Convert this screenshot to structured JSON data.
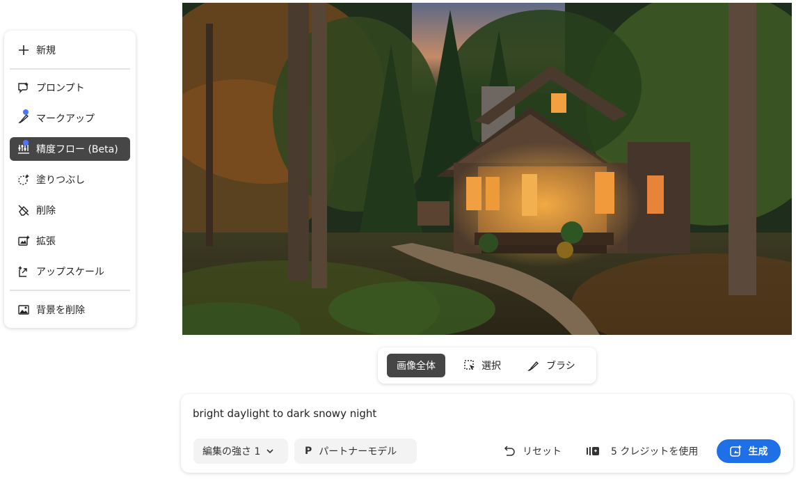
{
  "tools": {
    "new_label": "新規",
    "prompt_label": "プロンプト",
    "markup_label": "マークアップ",
    "precision_flow_label": "精度フロー (Beta)",
    "fill_label": "塗りつぶし",
    "remove_label": "削除",
    "expand_label": "拡張",
    "upscale_label": "アップスケール",
    "remove_bg_label": "背景を削除"
  },
  "scope": {
    "whole_image": "画像全体",
    "select": "選択",
    "brush": "ブラシ"
  },
  "prompt": {
    "text": "bright daylight to dark snowy night",
    "strength_label": "編集の強さ 1",
    "partner_badge": "P",
    "partner_label": "パートナーモデル",
    "reset_label": "リセット",
    "credits_label": "5 クレジットを使用",
    "generate_label": "生成"
  },
  "colors": {
    "accent": "#1f6fe6",
    "active_tool": "#464646",
    "indicator_dot": "#4b75ff"
  }
}
